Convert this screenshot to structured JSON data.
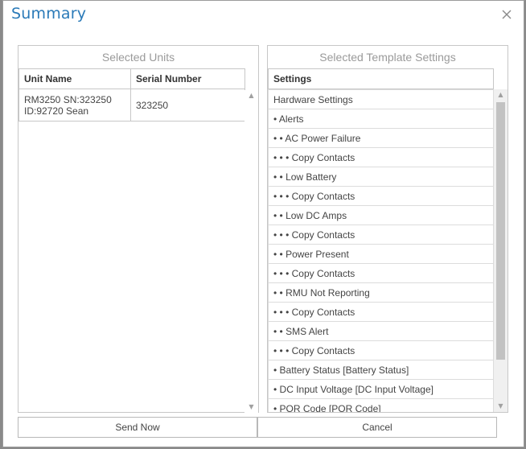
{
  "dialog": {
    "title": "Summary",
    "close_icon": "close-icon"
  },
  "units_panel": {
    "caption": "Selected Units",
    "columns": [
      "Unit Name",
      "Serial Number"
    ],
    "rows": [
      {
        "unit_name_line1": "RM3250 SN:323250",
        "unit_name_line2": "ID:92720 Sean",
        "serial": "323250"
      }
    ]
  },
  "settings_panel": {
    "caption": "Selected Template Settings",
    "column": "Settings",
    "rows": [
      "Hardware Settings",
      "• Alerts",
      "• • AC Power Failure",
      "• • • Copy Contacts",
      "• • Low Battery",
      "• • • Copy Contacts",
      "• • Low DC Amps",
      "• • • Copy Contacts",
      "• • Power Present",
      "• • • Copy Contacts",
      "• • RMU Not Reporting",
      "• • • Copy Contacts",
      "• • SMS Alert",
      "• • • Copy Contacts",
      "• Battery Status [Battery Status]",
      "• DC Input Voltage [DC Input Voltage]",
      "• POR Code [POR Code]"
    ]
  },
  "buttons": {
    "send_now": "Send Now",
    "cancel": "Cancel"
  },
  "colors": {
    "title": "#2a7ab8",
    "border": "#c7c7c7",
    "scroll_thumb": "#c2c2c2"
  }
}
